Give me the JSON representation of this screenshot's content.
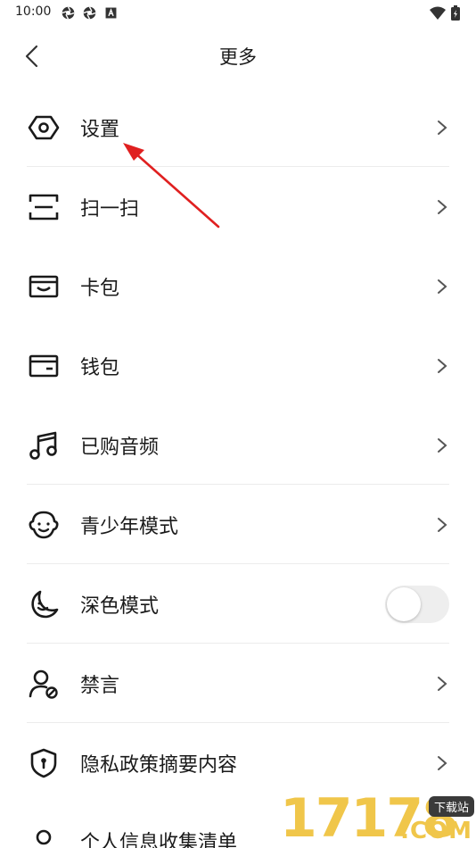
{
  "status_bar": {
    "time": "10:00",
    "left_icons": [
      "aperture-icon",
      "aperture-icon",
      "font-icon"
    ],
    "right_icons": [
      "wifi-icon",
      "battery-icon"
    ]
  },
  "header": {
    "back_icon": "chevron-left-icon",
    "title": "更多"
  },
  "menu": {
    "items": [
      {
        "key": "settings",
        "icon": "hexagon-settings-icon",
        "label": "设置",
        "control": "chevron"
      },
      {
        "key": "scan",
        "icon": "scan-icon",
        "label": "扫一扫",
        "control": "chevron"
      },
      {
        "key": "card-pack",
        "icon": "card-icon",
        "label": "卡包",
        "control": "chevron"
      },
      {
        "key": "wallet",
        "icon": "wallet-icon",
        "label": "钱包",
        "control": "chevron"
      },
      {
        "key": "purchased-audio",
        "icon": "music-note-icon",
        "label": "已购音频",
        "control": "chevron"
      },
      {
        "key": "teen-mode",
        "icon": "child-face-icon",
        "label": "青少年模式",
        "control": "chevron"
      },
      {
        "key": "dark-mode",
        "icon": "moon-icon",
        "label": "深色模式",
        "control": "toggle",
        "toggle_on": false
      },
      {
        "key": "mute",
        "icon": "user-blocked-icon",
        "label": "禁言",
        "control": "chevron"
      },
      {
        "key": "privacy-summary",
        "icon": "shield-lock-icon",
        "label": "隐私政策摘要内容",
        "control": "chevron"
      }
    ],
    "partial_item": {
      "icon": "user-icon",
      "label": "个人信息收集清单"
    }
  },
  "annotation": {
    "type": "red-arrow",
    "points_to": "settings",
    "color": "#e02020"
  },
  "watermark": {
    "digits": "17178",
    "badge": "下载站",
    "suffix": ".COM",
    "color": "#f0c64a"
  },
  "colors": {
    "text": "#1a1a1a",
    "divider": "#ececec",
    "chevron": "#555555",
    "toggle_track": "#eeeeee"
  }
}
